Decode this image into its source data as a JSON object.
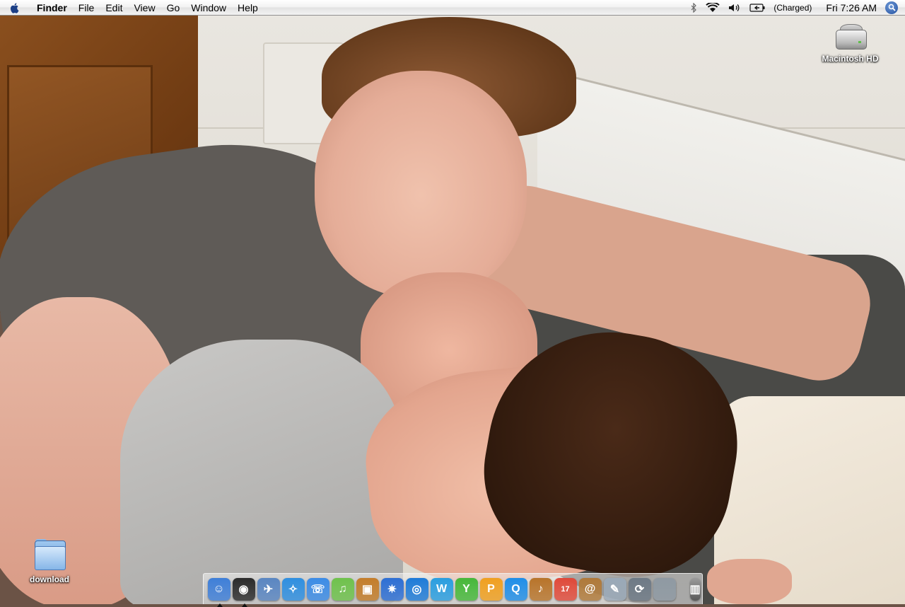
{
  "menubar": {
    "app_name": "Finder",
    "menus": [
      "File",
      "Edit",
      "View",
      "Go",
      "Window",
      "Help"
    ],
    "battery_status": "(Charged)",
    "clock": "Fri 7:26 AM",
    "status_icons": [
      "bluetooth-icon",
      "wifi-icon",
      "volume-icon",
      "battery-icon",
      "spotlight-icon"
    ]
  },
  "desktop": {
    "icons": [
      {
        "label": "Macintosh HD",
        "icon": "hard-drive-icon"
      },
      {
        "label": "download",
        "icon": "folder-icon"
      }
    ]
  },
  "dock": {
    "apps": [
      {
        "name": "finder-icon",
        "glyph": "☺",
        "color": "#3f7fd8",
        "running": true
      },
      {
        "name": "dashboard-icon",
        "glyph": "◉",
        "color": "#2b2b2b",
        "running": true
      },
      {
        "name": "mail-icon",
        "glyph": "✈",
        "color": "#5a86c2",
        "running": false
      },
      {
        "name": "safari-icon",
        "glyph": "✧",
        "color": "#2f8fe0",
        "running": false
      },
      {
        "name": "ichat-icon",
        "glyph": "☏",
        "color": "#3c8ce6",
        "running": false
      },
      {
        "name": "itunes-icon",
        "glyph": "♫",
        "color": "#6fc24c",
        "running": false
      },
      {
        "name": "iphoto-icon",
        "glyph": "▣",
        "color": "#c47d2a",
        "running": false
      },
      {
        "name": "imovie-icon",
        "glyph": "✷",
        "color": "#2d6fd4",
        "running": false
      },
      {
        "name": "idvd-icon",
        "glyph": "◎",
        "color": "#1e7bd8",
        "running": false
      },
      {
        "name": "iweb-icon",
        "glyph": "W",
        "color": "#2a9ee0",
        "running": false
      },
      {
        "name": "numbers-icon",
        "glyph": "Y",
        "color": "#46b83a",
        "running": false
      },
      {
        "name": "pages-icon",
        "glyph": "P",
        "color": "#f0a020",
        "running": false
      },
      {
        "name": "quicktime-icon",
        "glyph": "Q",
        "color": "#1f8ee8",
        "running": false
      },
      {
        "name": "garageband-icon",
        "glyph": "♪",
        "color": "#b8742a",
        "running": false
      },
      {
        "name": "ical-icon",
        "glyph": "17",
        "color": "#e04a3a",
        "running": false
      },
      {
        "name": "address-book-icon",
        "glyph": "@",
        "color": "#b07a3a",
        "running": false
      },
      {
        "name": "preview-icon",
        "glyph": "✎",
        "color": "#9aa9b8",
        "running": false
      },
      {
        "name": "time-machine-icon",
        "glyph": "⟳",
        "color": "#6e7a86",
        "running": false
      },
      {
        "name": "system-preferences-icon",
        "glyph": "",
        "color": "#8f9aa3",
        "running": false
      }
    ],
    "trash": {
      "name": "trash-icon",
      "glyph": "▥",
      "color": "#5a5a5a"
    }
  }
}
